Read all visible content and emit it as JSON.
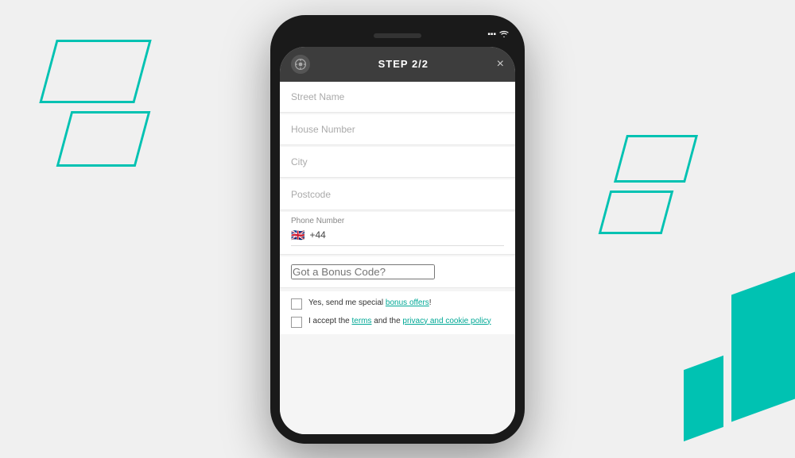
{
  "background_color": "#f0f0f0",
  "accent_color": "#00c2b2",
  "phone": {
    "header": {
      "title": "STEP 2/2",
      "close_label": "×",
      "logo_alt": "app-logo"
    },
    "form": {
      "fields": [
        {
          "id": "street-name",
          "placeholder": "Street Name",
          "value": ""
        },
        {
          "id": "house-number",
          "placeholder": "House Number",
          "value": ""
        },
        {
          "id": "city",
          "placeholder": "City",
          "value": ""
        },
        {
          "id": "postcode",
          "placeholder": "Postcode",
          "value": ""
        }
      ],
      "phone_field": {
        "label": "Phone Number",
        "flag": "🇬🇧",
        "code": "+44",
        "placeholder": ""
      },
      "bonus_field": {
        "placeholder": "Got a Bonus Code?"
      },
      "checkboxes": [
        {
          "id": "marketing",
          "text_before": "Yes, send me special ",
          "link_text": "bonus offers",
          "text_after": "!"
        },
        {
          "id": "terms",
          "text_before": "I accept the ",
          "link1_text": "terms",
          "text_middle": " and the ",
          "link2_text": "privacy and cookie policy"
        }
      ]
    }
  },
  "status": {
    "signal": "📶",
    "wifi": "🛜"
  }
}
